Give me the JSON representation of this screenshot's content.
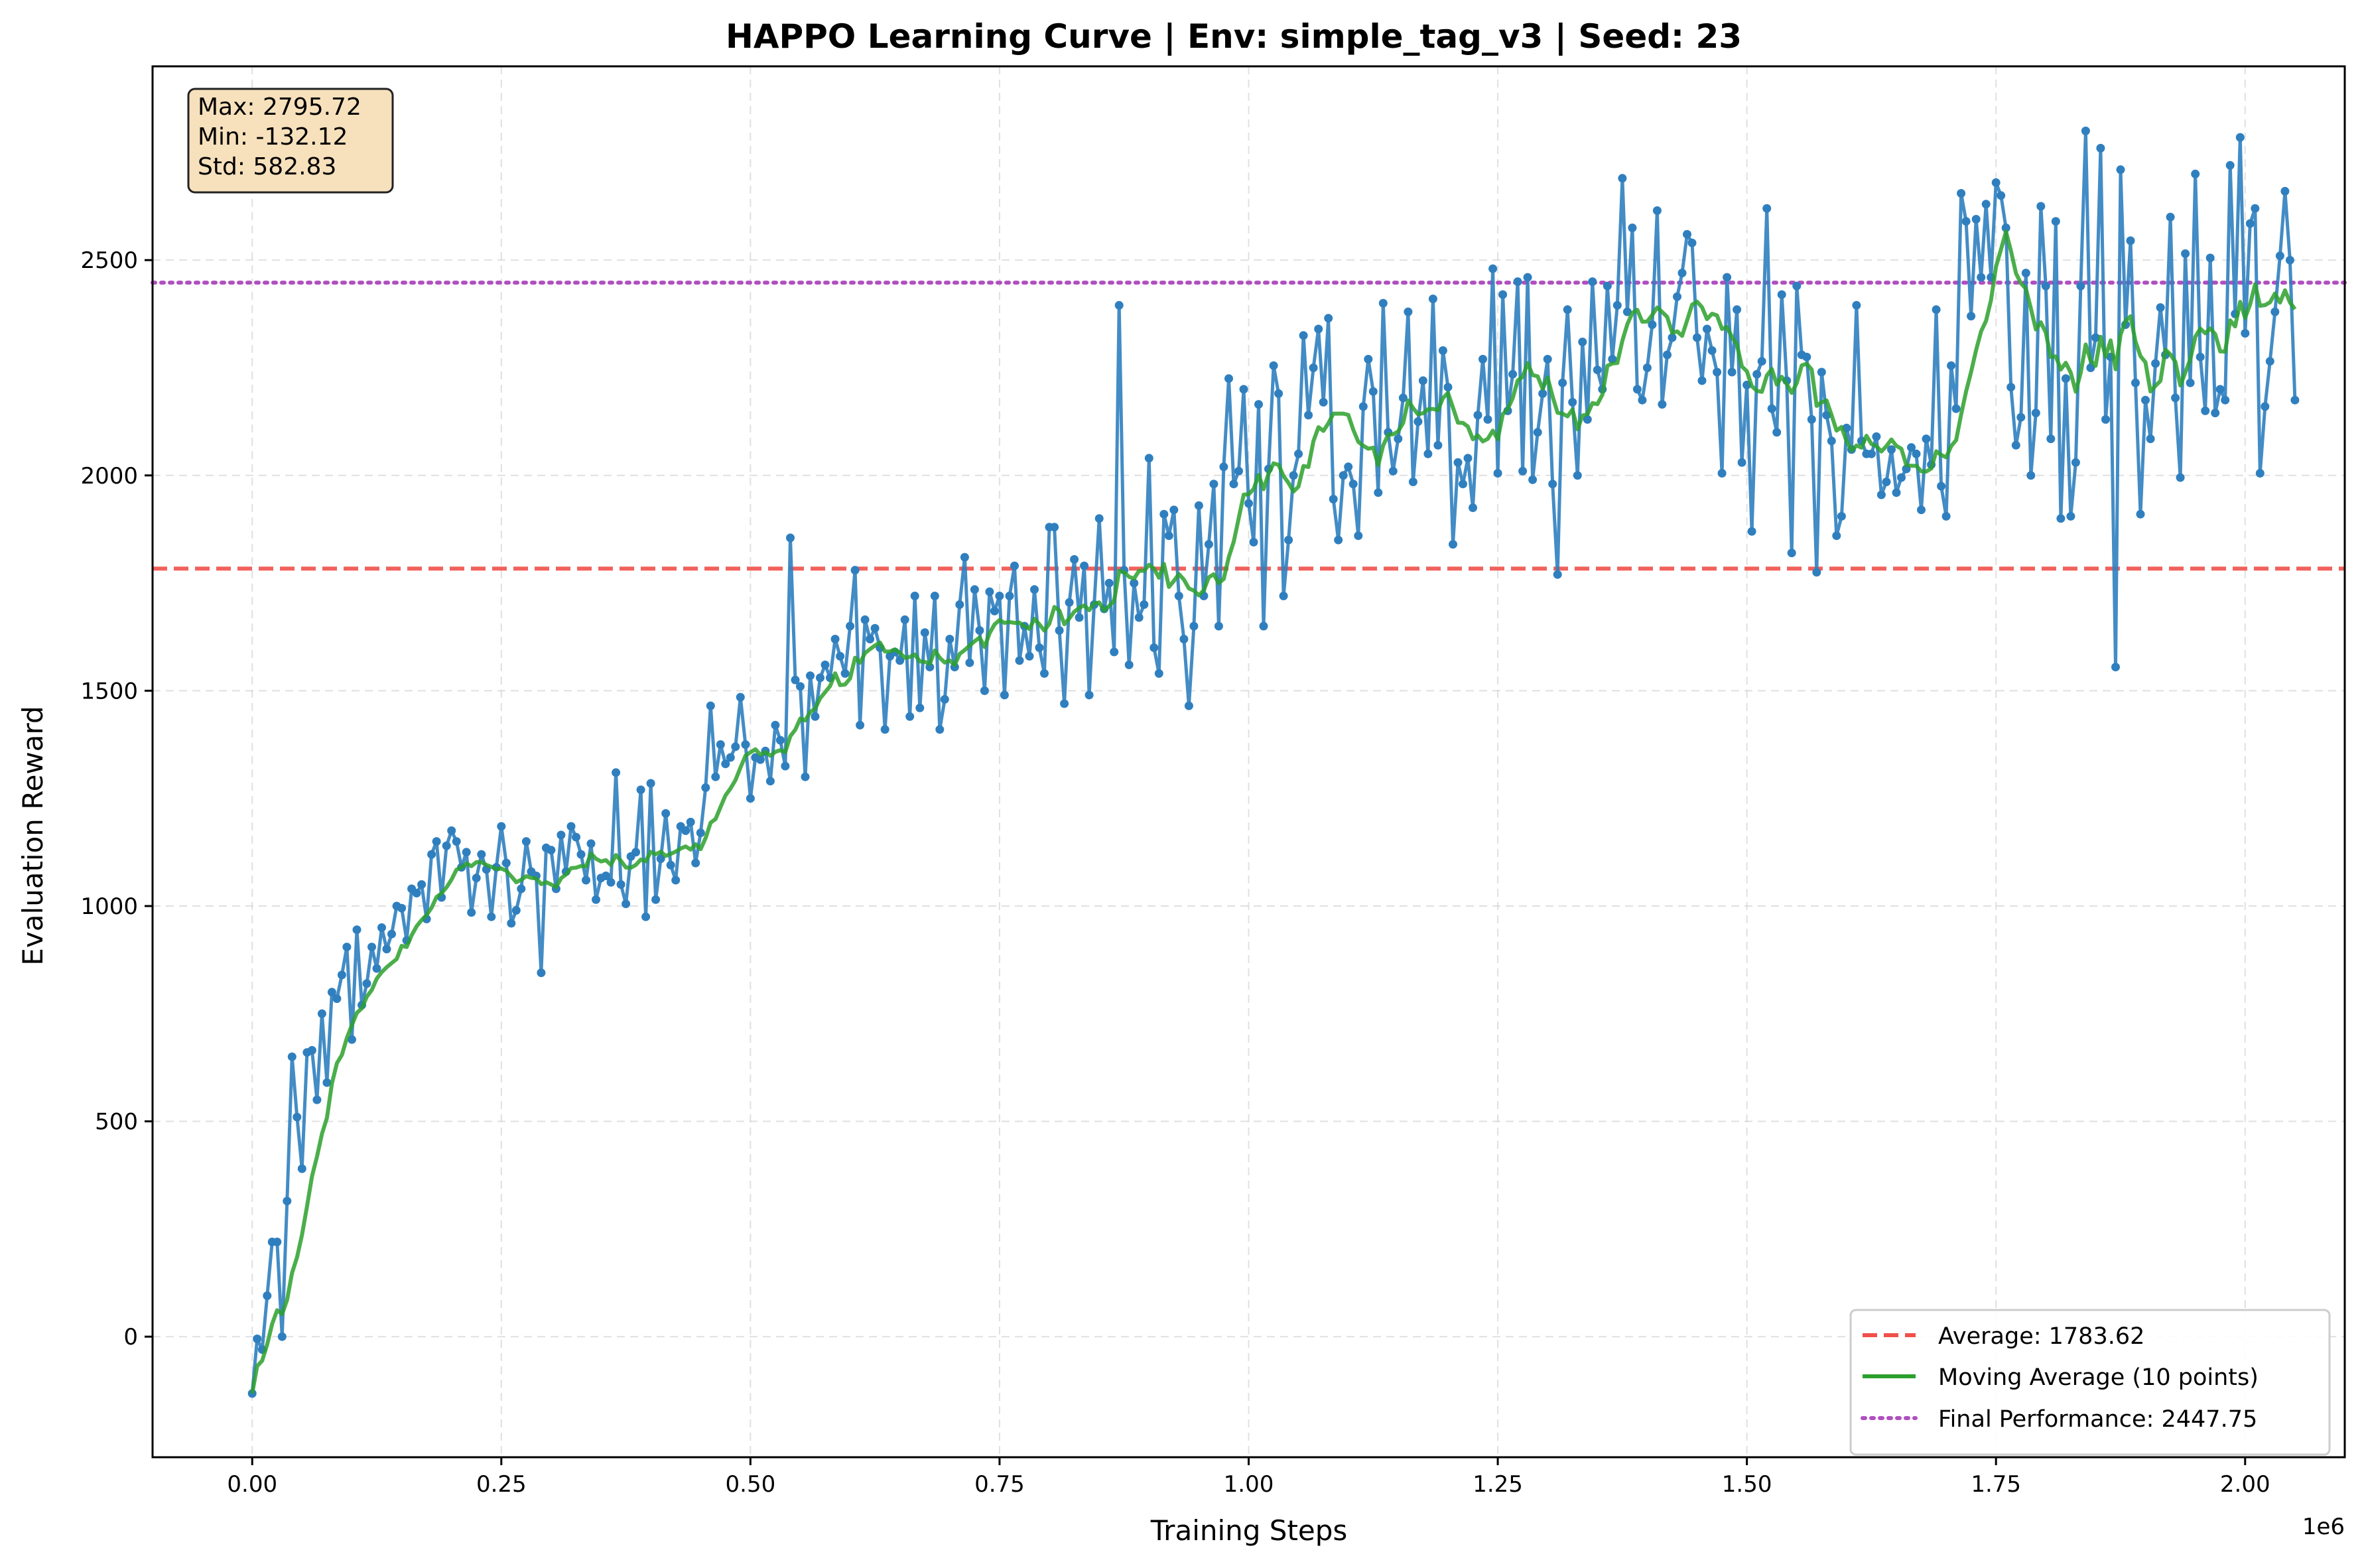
{
  "chart_data": {
    "type": "line",
    "title": "HAPPO Learning Curve | Env: simple_tag_v3 | Seed: 23",
    "xlabel": "Training Steps",
    "ylabel": "Evaluation Reward",
    "x_offset_label": "1e6",
    "xlim": [
      -0.1,
      2.1
    ],
    "ylim": [
      -280,
      2950
    ],
    "xticks": [
      0.0,
      0.25,
      0.5,
      0.75,
      1.0,
      1.25,
      1.5,
      1.75,
      2.0
    ],
    "xtick_labels": [
      "0.00",
      "0.25",
      "0.50",
      "0.75",
      "1.00",
      "1.25",
      "1.50",
      "1.75",
      "2.00"
    ],
    "yticks": [
      0,
      500,
      1000,
      1500,
      2000,
      2500
    ],
    "ytick_labels": [
      "0",
      "500",
      "1000",
      "1500",
      "2000",
      "2500"
    ],
    "grid": true,
    "legend_position": "lower-right",
    "stats_box": {
      "lines": [
        "Max: 2795.72",
        "Min: -132.12",
        "Std: 582.83"
      ]
    },
    "series": [
      {
        "name": "",
        "style": "line-with-markers",
        "color": "#2f7fbf",
        "x_step": 0.005,
        "x_start": 0.0,
        "values": [
          -132,
          -5,
          -30,
          95,
          220,
          220,
          0,
          315,
          650,
          510,
          390,
          660,
          665,
          550,
          750,
          590,
          800,
          785,
          840,
          905,
          690,
          945,
          770,
          820,
          905,
          855,
          950,
          900,
          935,
          1000,
          995,
          920,
          1040,
          1030,
          1050,
          970,
          1120,
          1150,
          1020,
          1140,
          1175,
          1150,
          1090,
          1125,
          985,
          1065,
          1120,
          1085,
          975,
          1090,
          1185,
          1100,
          960,
          990,
          1040,
          1150,
          1080,
          1070,
          845,
          1135,
          1130,
          1040,
          1165,
          1080,
          1185,
          1160,
          1120,
          1060,
          1145,
          1015,
          1065,
          1070,
          1055,
          1310,
          1050,
          1005,
          1115,
          1125,
          1270,
          975,
          1285,
          1015,
          1110,
          1215,
          1095,
          1060,
          1185,
          1175,
          1195,
          1100,
          1170,
          1275,
          1465,
          1300,
          1375,
          1330,
          1345,
          1370,
          1485,
          1375,
          1250,
          1345,
          1340,
          1360,
          1290,
          1420,
          1385,
          1325,
          1855,
          1525,
          1510,
          1300,
          1535,
          1440,
          1530,
          1560,
          1530,
          1620,
          1580,
          1540,
          1650,
          1780,
          1420,
          1665,
          1620,
          1645,
          1600,
          1410,
          1580,
          1590,
          1570,
          1665,
          1440,
          1720,
          1460,
          1635,
          1555,
          1720,
          1410,
          1480,
          1620,
          1555,
          1700,
          1810,
          1565,
          1735,
          1640,
          1500,
          1730,
          1685,
          1720,
          1490,
          1720,
          1790,
          1570,
          1650,
          1580,
          1735,
          1600,
          1540,
          1880,
          1880,
          1640,
          1470,
          1705,
          1805,
          1670,
          1790,
          1490,
          1700,
          1900,
          1690,
          1750,
          1590,
          2395,
          1780,
          1560,
          1750,
          1670,
          1700,
          2040,
          1600,
          1540,
          1910,
          1860,
          1920,
          1720,
          1620,
          1465,
          1650,
          1930,
          1720,
          1840,
          1980,
          1650,
          2020,
          2225,
          1980,
          2010,
          2200,
          1935,
          1845,
          2165,
          1650,
          2015,
          2255,
          2190,
          1720,
          1850,
          2000,
          2050,
          2325,
          2140,
          2250,
          2340,
          2170,
          2365,
          1945,
          1850,
          2000,
          2020,
          1980,
          1860,
          2160,
          2270,
          2195,
          1960,
          2400,
          2100,
          2010,
          2085,
          2180,
          2380,
          1985,
          2125,
          2220,
          2050,
          2410,
          2070,
          2290,
          2205,
          1840,
          2030,
          1980,
          2040,
          1925,
          2140,
          2270,
          2130,
          2480,
          2005,
          2420,
          2150,
          2235,
          2450,
          2010,
          2460,
          1990,
          2100,
          2190,
          2270,
          1980,
          1770,
          2215,
          2385,
          2170,
          2000,
          2310,
          2130,
          2450,
          2245,
          2200,
          2440,
          2270,
          2395,
          2690,
          2380,
          2575,
          2200,
          2175,
          2250,
          2350,
          2615,
          2165,
          2280,
          2320,
          2415,
          2470,
          2560,
          2540,
          2320,
          2220,
          2340,
          2290,
          2240,
          2005,
          2460,
          2240,
          2385,
          2030,
          2210,
          1870,
          2235,
          2265,
          2620,
          2155,
          2100,
          2420,
          2220,
          1820,
          2440,
          2280,
          2275,
          2130,
          1775,
          2240,
          2140,
          2080,
          1860,
          1905,
          2110,
          2060,
          2395,
          2080,
          2050,
          2050,
          2090,
          1955,
          1985,
          2060,
          1960,
          1995,
          2015,
          2065,
          2050,
          1920,
          2085,
          2025,
          2385,
          1975,
          1905,
          2255,
          2155,
          2655,
          2590,
          2370,
          2595,
          2460,
          2630,
          2460,
          2680,
          2650,
          2575,
          2205,
          2070,
          2135,
          2470,
          2000,
          2145,
          2625,
          2440,
          2085,
          2590,
          1900,
          2225,
          1905,
          2030,
          2440,
          2800,
          2250,
          2320,
          2760,
          2130,
          2275,
          1555,
          2710,
          2350,
          2545,
          2215,
          1910,
          2175,
          2085,
          2260,
          2390,
          2280,
          2600,
          2180,
          1995,
          2515,
          2215,
          2700,
          2275,
          2150,
          2505,
          2145,
          2200,
          2175,
          2720,
          2375,
          2785,
          2330,
          2585,
          2620,
          2005,
          2160,
          2265,
          2380,
          2510,
          2660,
          2500,
          2175
        ]
      },
      {
        "name": "Moving Average (10 points)",
        "style": "line",
        "color": "#2ca02c",
        "window": 10
      }
    ],
    "reference_lines": [
      {
        "name": "Average: 1783.62",
        "value": 1783.62,
        "style": "dashed",
        "color": "#f0504a"
      },
      {
        "name": "Final Performance: 2447.75",
        "value": 2447.75,
        "style": "dotted",
        "color": "#b04fc0"
      }
    ]
  }
}
